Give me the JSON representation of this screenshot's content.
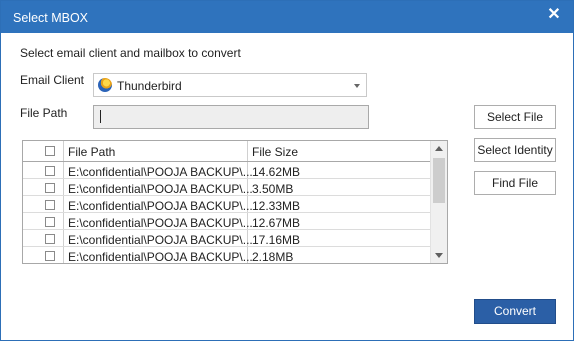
{
  "window": {
    "title": "Select MBOX",
    "close_glyph": "✕"
  },
  "instruction": "Select email client and mailbox to convert",
  "email_client": {
    "label": "Email Client",
    "selected": "Thunderbird",
    "icon": "thunderbird-icon"
  },
  "file_path": {
    "label": "File Path",
    "value": ""
  },
  "table": {
    "columns": [
      "File Path",
      "File Size"
    ],
    "rows": [
      {
        "path": "E:\\confidential\\POOJA BACKUP\\...",
        "size": "14.62MB"
      },
      {
        "path": "E:\\confidential\\POOJA BACKUP\\...",
        "size": "3.50MB"
      },
      {
        "path": "E:\\confidential\\POOJA BACKUP\\...",
        "size": "12.33MB"
      },
      {
        "path": "E:\\confidential\\POOJA BACKUP\\...",
        "size": "12.67MB"
      },
      {
        "path": "E:\\confidential\\POOJA BACKUP\\...",
        "size": "17.16MB"
      },
      {
        "path": "E:\\confidential\\POOJA BACKUP\\...",
        "size": "2.18MB"
      }
    ]
  },
  "buttons": {
    "select_file": "Select File",
    "select_identity": "Select Identity",
    "find_file": "Find File",
    "convert": "Convert"
  },
  "colors": {
    "titlebar": "#2f73bd",
    "primary_button": "#2b5fa6"
  }
}
